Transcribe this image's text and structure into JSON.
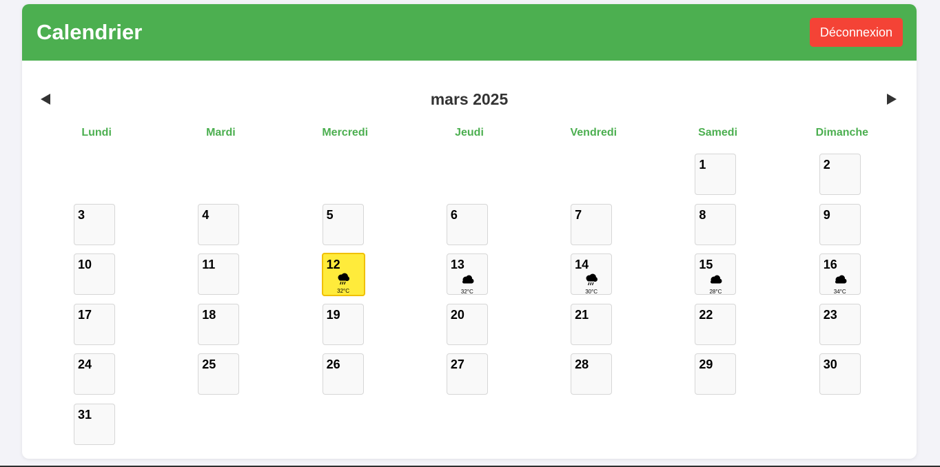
{
  "header": {
    "title": "Calendrier",
    "logout_label": "Déconnexion"
  },
  "nav": {
    "month_title": "mars 2025",
    "prev_icon": "triangle-left-icon",
    "next_icon": "triangle-right-icon"
  },
  "weekdays": [
    "Lundi",
    "Mardi",
    "Mercredi",
    "Jeudi",
    "Vendredi",
    "Samedi",
    "Dimanche"
  ],
  "calendar": {
    "leading_blank_days": 5,
    "today": 12,
    "days": [
      {
        "n": "1"
      },
      {
        "n": "2"
      },
      {
        "n": "3"
      },
      {
        "n": "4"
      },
      {
        "n": "5"
      },
      {
        "n": "6"
      },
      {
        "n": "7"
      },
      {
        "n": "8"
      },
      {
        "n": "9"
      },
      {
        "n": "10"
      },
      {
        "n": "11"
      },
      {
        "n": "12",
        "weather": "rain-cloud-icon",
        "temp": "32°C"
      },
      {
        "n": "13",
        "weather": "cloudy-icon",
        "temp": "32°C"
      },
      {
        "n": "14",
        "weather": "rain-cloud-icon",
        "temp": "30°C"
      },
      {
        "n": "15",
        "weather": "cloudy-icon",
        "temp": "28°C"
      },
      {
        "n": "16",
        "weather": "cloudy-icon",
        "temp": "34°C"
      },
      {
        "n": "17"
      },
      {
        "n": "18"
      },
      {
        "n": "19"
      },
      {
        "n": "20"
      },
      {
        "n": "21"
      },
      {
        "n": "22"
      },
      {
        "n": "23"
      },
      {
        "n": "24"
      },
      {
        "n": "25"
      },
      {
        "n": "26"
      },
      {
        "n": "27"
      },
      {
        "n": "28"
      },
      {
        "n": "29"
      },
      {
        "n": "30"
      },
      {
        "n": "31"
      }
    ]
  },
  "colors": {
    "accent": "#4caf50",
    "danger": "#f44336",
    "today": "#ffeb3b"
  }
}
